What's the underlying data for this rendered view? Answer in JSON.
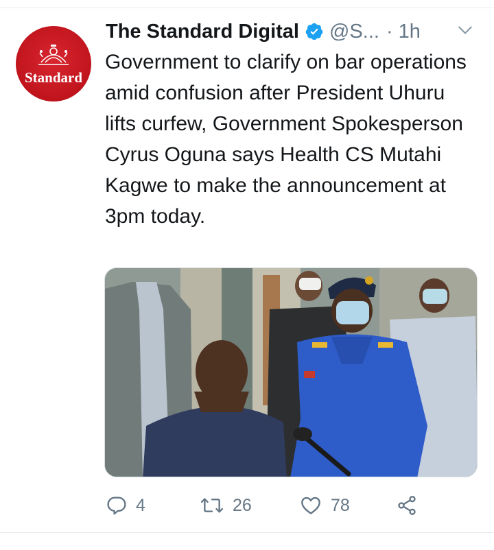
{
  "tweet": {
    "avatar_logo_text": "Standard",
    "display_name": "The Standard Digital",
    "handle": "@S...",
    "separator": "·",
    "time": "1h",
    "text": "Government to clarify on bar operations amid confusion after President Uhuru lifts curfew, Government Spokesperson Cyrus Oguna says Health CS Mutahi Kagwe to make the announcement at 3pm today.",
    "media_icon": "photo",
    "actions": {
      "reply_count": "4",
      "retweet_count": "26",
      "like_count": "78"
    }
  },
  "icons": {
    "verified": "verified-badge-icon",
    "caret": "chevron-down-icon",
    "reply": "reply-icon",
    "retweet": "retweet-icon",
    "like": "heart-icon",
    "share": "share-icon"
  },
  "colors": {
    "text": "#14171a",
    "secondary": "#657786",
    "verified_blue": "#1da1f2",
    "avatar_red": "#c0141d",
    "divider": "#e6ecf0"
  }
}
